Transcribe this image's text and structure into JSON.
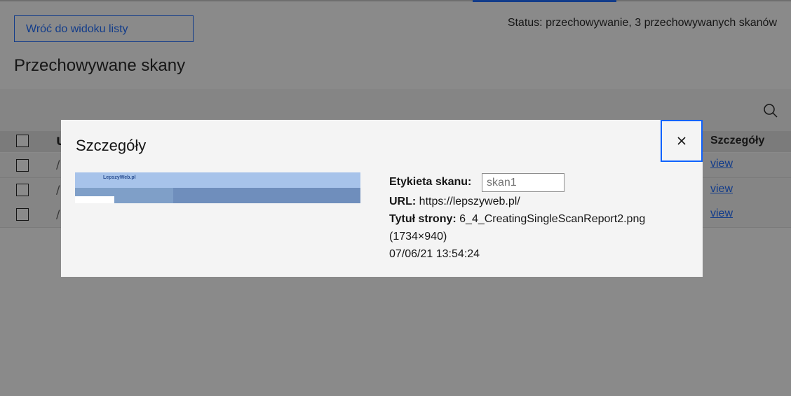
{
  "header": {
    "back_button_label": "Wróć do widoku listy",
    "status_text": "Status: przechowywanie, 3 przechowywanych skanów",
    "page_title": "Przechowywane skany"
  },
  "table": {
    "columns": [
      "U",
      "Szczegóły"
    ],
    "rows": [
      {
        "first_cell": "/",
        "details_link": "view"
      },
      {
        "first_cell": "/",
        "details_link": "view"
      },
      {
        "first_cell": "/",
        "details_link": "view"
      }
    ]
  },
  "modal": {
    "title": "Szczegóły",
    "scan_label_caption": "Etykieta skanu:",
    "scan_label_value": "skan1",
    "url_caption": "URL:",
    "url_value": "https://lepszyweb.pl/",
    "page_title_caption": "Tytuł strony:",
    "page_title_value": "6_4_CreatingSingleScanReport2.png",
    "dimensions": "(1734×940)",
    "timestamp": "07/06/21 13:54:24",
    "thumbnail_logo_text": "LepszyWeb.pl"
  },
  "icons": {
    "search": "search-icon",
    "close": "close-icon"
  },
  "colors": {
    "accent": "#0f62fe",
    "overlay": "rgba(22,22,22,0.5)",
    "modal_bg": "#f4f4f4"
  }
}
